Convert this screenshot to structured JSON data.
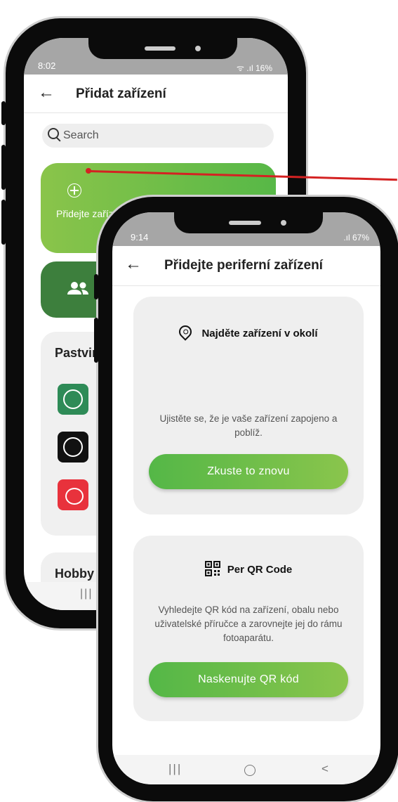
{
  "colors": {
    "accent_green": "#57b847",
    "dark_green": "#3d7f3d",
    "callout_red": "#d42222"
  },
  "back_screen": {
    "status": {
      "time": "8:02",
      "right": "ᯤ .ıl 16%"
    },
    "title": "Přidat zařízení",
    "search_placeholder": "Search",
    "add_card_text": "Přidejte zařízení poblíž nebo pomocí QR kódu",
    "family_label": "r",
    "group1_title": "Pastvin",
    "group2_title": "Hobby f",
    "nav_recents": "|||"
  },
  "front_screen": {
    "status": {
      "time": "9:14",
      "right": ".ıl 67%"
    },
    "title": "Přidejte periferní zařízení",
    "nearby": {
      "heading": "Najděte zařízení v okolí",
      "description": "Ujistěte se, že je vaše zařízení zapojeno a poblíž.",
      "button": "Zkuste to znovu"
    },
    "qr": {
      "heading": "Per QR Code",
      "description": "Vyhledejte QR kód na zařízení, obalu nebo uživatelské příručce a zarovnejte jej do rámu fotoaparátu.",
      "button": "Naskenujte QR kód"
    },
    "nav": {
      "recents": "|||",
      "back": "<"
    }
  }
}
